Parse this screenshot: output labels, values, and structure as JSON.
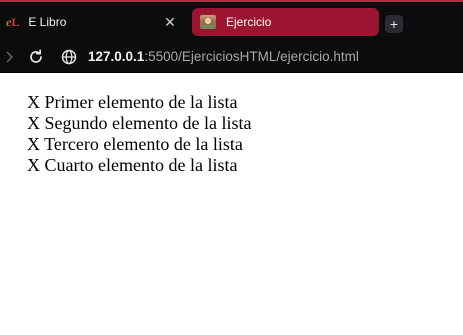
{
  "tabs": [
    {
      "label": "E Libro",
      "logo_e": "e",
      "logo_l": "L",
      "close": "✕"
    },
    {
      "label": "Ejercicio"
    }
  ],
  "new_tab": "+",
  "address_bar": {
    "host": "127.0.0.1",
    "rest": ":5500/EjerciciosHTML/ejercicio.html"
  },
  "page": {
    "items": [
      "X Primer elemento de la lista",
      "X Segundo elemento de la lista",
      "X Tercero elemento de la lista",
      "X Cuarto elemento de la lista"
    ]
  },
  "colors": {
    "chrome_bg": "#0c0c0f",
    "active_tab": "#9c1530",
    "accent": "#d0213f"
  },
  "icons": [
    "forward-arrow-icon",
    "reload-icon",
    "globe-icon",
    "close-icon",
    "plus-icon"
  ]
}
